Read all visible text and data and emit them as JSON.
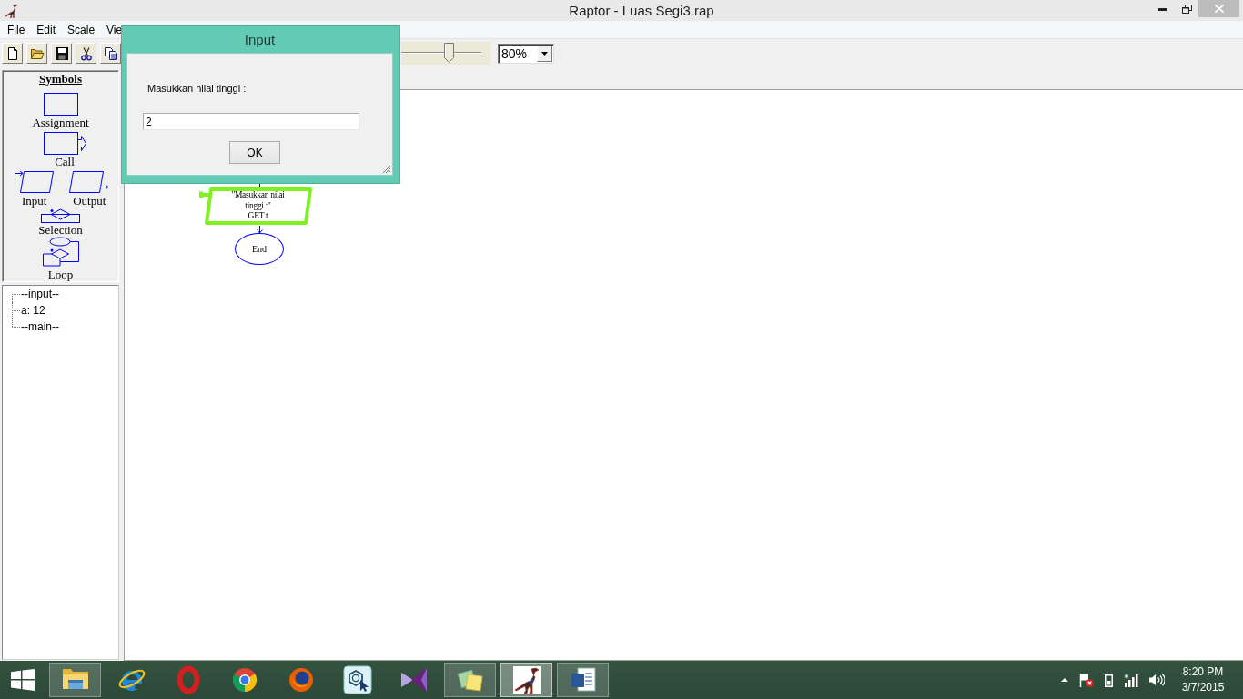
{
  "window": {
    "title": "Raptor - Luas Segi3.rap"
  },
  "menu": [
    "File",
    "Edit",
    "Scale",
    "Vie"
  ],
  "toolbar": {
    "buttons": [
      {
        "kind": "new"
      },
      {
        "kind": "open"
      },
      {
        "kind": "save"
      },
      {
        "kind": "cut"
      },
      {
        "kind": "copy"
      }
    ],
    "zoom": {
      "level": 0.54,
      "value": "80%"
    }
  },
  "symbols": {
    "title": "Symbols",
    "items": [
      {
        "kind": "assignment",
        "label": "Assignment"
      },
      {
        "kind": "call",
        "label": "Call"
      },
      {
        "kind": "input",
        "label": "Input"
      },
      {
        "kind": "output",
        "label": "Output"
      },
      {
        "kind": "selection",
        "label": "Selection"
      },
      {
        "kind": "loop",
        "label": "Loop"
      }
    ]
  },
  "variables": [
    {
      "label": "--input--"
    },
    {
      "label": "a: 12"
    },
    {
      "label": "--main--"
    }
  ],
  "flowchart": {
    "symbols": [
      {
        "kind": "input",
        "prompt": "\"Masukkan nilai tinggi :\"",
        "statement": "GET t",
        "executing": true
      },
      {
        "kind": "end",
        "label": "End",
        "executing": false
      }
    ]
  },
  "dialog": {
    "title": "Input",
    "prompt": "Masukkan nilai tinggi :",
    "value": "2",
    "button": "OK"
  },
  "taskbar": {
    "apps": [
      {
        "kind": "explorer",
        "running": true,
        "selected": false
      },
      {
        "kind": "internet_explorer",
        "running": false,
        "selected": false
      },
      {
        "kind": "opera",
        "running": false,
        "selected": false
      },
      {
        "kind": "chrome",
        "running": false,
        "selected": false
      },
      {
        "kind": "firefox",
        "running": false,
        "selected": false
      },
      {
        "kind": "hexagon_tool",
        "running": false,
        "selected": false
      },
      {
        "kind": "visual_studio",
        "running": false,
        "selected": false
      },
      {
        "kind": "sticky_notes",
        "running": true,
        "selected": false
      },
      {
        "kind": "raptor",
        "running": true,
        "selected": true
      },
      {
        "kind": "word",
        "running": true,
        "selected": false
      }
    ],
    "time": "8:20 PM",
    "date": "3/7/2015"
  }
}
